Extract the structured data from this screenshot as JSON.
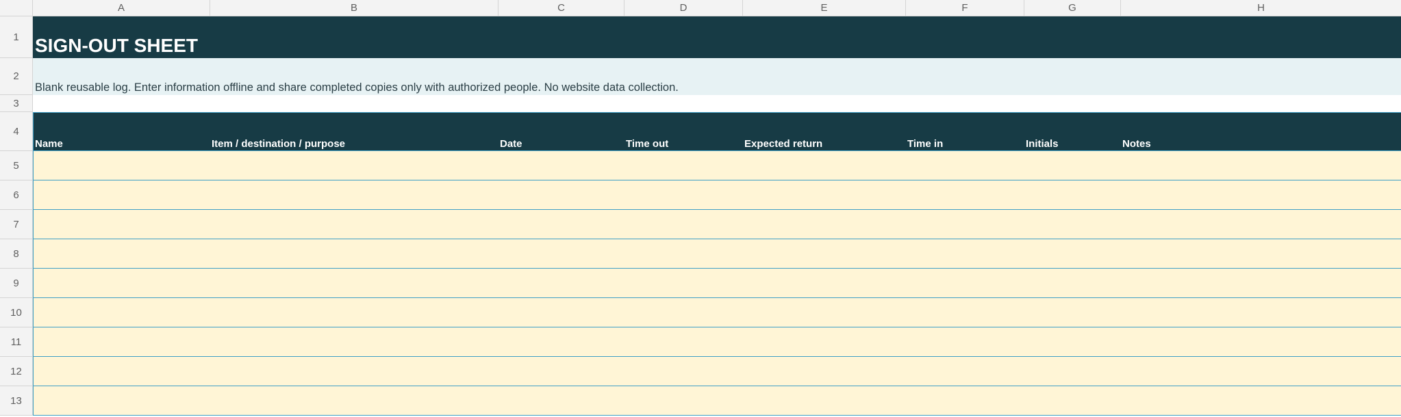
{
  "columns": [
    "A",
    "B",
    "C",
    "D",
    "E",
    "F",
    "G",
    "H"
  ],
  "row_numbers": [
    "1",
    "2",
    "3",
    "4",
    "5",
    "6",
    "7",
    "8",
    "9",
    "10",
    "11",
    "12",
    "13"
  ],
  "title": "SIGN-OUT SHEET",
  "subtitle": "Blank reusable log. Enter information offline and share completed copies only with authorized people. No website data collection.",
  "table": {
    "headers": [
      "Name",
      "Item / destination / purpose",
      "Date",
      "Time out",
      "Expected return",
      "Time in",
      "Initials",
      "Notes"
    ],
    "rows": [
      [
        "",
        "",
        "",
        "",
        "",
        "",
        "",
        ""
      ],
      [
        "",
        "",
        "",
        "",
        "",
        "",
        "",
        ""
      ],
      [
        "",
        "",
        "",
        "",
        "",
        "",
        "",
        ""
      ],
      [
        "",
        "",
        "",
        "",
        "",
        "",
        "",
        ""
      ],
      [
        "",
        "",
        "",
        "",
        "",
        "",
        "",
        ""
      ],
      [
        "",
        "",
        "",
        "",
        "",
        "",
        "",
        ""
      ],
      [
        "",
        "",
        "",
        "",
        "",
        "",
        "",
        ""
      ],
      [
        "",
        "",
        "",
        "",
        "",
        "",
        "",
        ""
      ],
      [
        "",
        "",
        "",
        "",
        "",
        "",
        "",
        ""
      ]
    ]
  },
  "colors": {
    "title_band": "#173b45",
    "subtitle_band": "#e7f2f4",
    "input_fill": "#fff5d6",
    "grid_border": "#3f9fc6"
  }
}
